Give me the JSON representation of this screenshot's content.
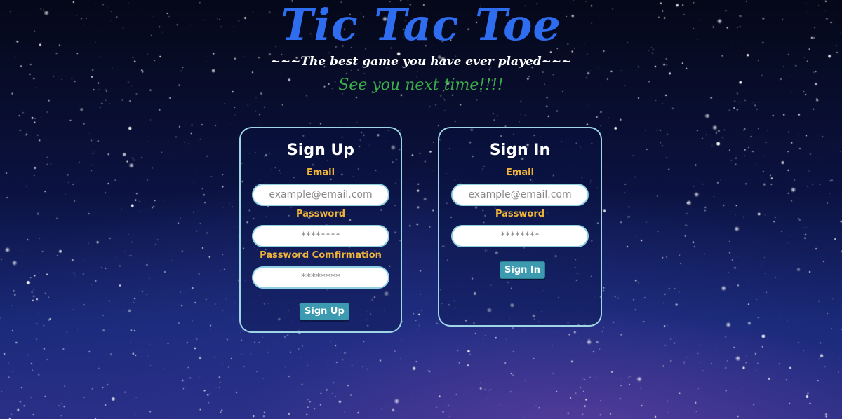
{
  "header": {
    "title": "Tic Tac Toe",
    "tagline": "~~~The best game you have ever played~~~",
    "farewell": "See you next time!!!!"
  },
  "signup": {
    "heading": "Sign Up",
    "email_label": "Email",
    "email_placeholder": "example@email.com",
    "password_label": "Password",
    "password_placeholder": "********",
    "confirm_label": "Password Comfirmation",
    "confirm_placeholder": "********",
    "button_label": "Sign Up"
  },
  "signin": {
    "heading": "Sign In",
    "email_label": "Email",
    "email_placeholder": "example@email.com",
    "password_label": "Password",
    "password_placeholder": "********",
    "button_label": "Sign In"
  },
  "colors": {
    "title": "#2f6df0",
    "farewell": "#3cae4a",
    "label": "#f1b43a",
    "card_border": "#9fd6e6",
    "button": "#3c9bb0"
  }
}
